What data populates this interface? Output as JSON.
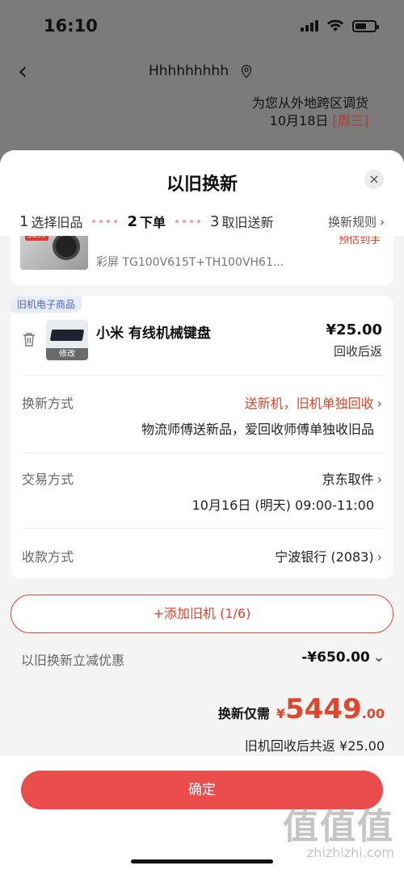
{
  "status_bar": {
    "time": "16:10"
  },
  "background": {
    "location_name": "Hhhhhhhhh",
    "ship_note": "为您从外地跨区调货",
    "ship_date": "10月18日",
    "ship_weekday": "[周三]"
  },
  "sheet": {
    "title": "以旧换新",
    "close": "×",
    "steps": [
      {
        "num": "1",
        "label": "选择旧品"
      },
      {
        "num": "2",
        "label": "下单"
      },
      {
        "num": "3",
        "label": "取旧送新"
      }
    ],
    "rules_link": "换新规则",
    "new_product": {
      "model": "彩屏 TG100V615T+TH100VH61...",
      "arrive_note": "预估到手",
      "thumb_tag": "5899"
    },
    "old_item": {
      "tag": "旧机电子商品",
      "name": "小米 有线机械键盘",
      "price": "¥25.00",
      "price_note": "回收后返",
      "edit": "修改",
      "rows": {
        "exchange_label": "换新方式",
        "exchange_value": "送新机，旧机单独回收",
        "exchange_sub": "物流师傅送新品，爱回收师傅单独收旧品",
        "trade_label": "交易方式",
        "trade_value": "京东取件",
        "trade_sub": "10月16日 (明天) 09:00-11:00",
        "payment_label": "收款方式",
        "payment_value": "宁波银行 (2083)"
      }
    },
    "add_button": "+添加旧机 (1/6)",
    "discount_label": "以旧换新立减优惠",
    "discount_value": "-¥650.00",
    "total_label": "换新仅需",
    "total_currency": "¥",
    "total_int": "5449",
    "total_dec": ".00",
    "return_line": "旧机回收后共返 ¥25.00",
    "confirm": "确定"
  },
  "watermark": {
    "big": "值值值",
    "small": "zhizhizhi.com"
  },
  "colors": {
    "accent": "#e0452e",
    "confirm": "#eb4d4d",
    "tag_bg": "#e7ecfb"
  }
}
